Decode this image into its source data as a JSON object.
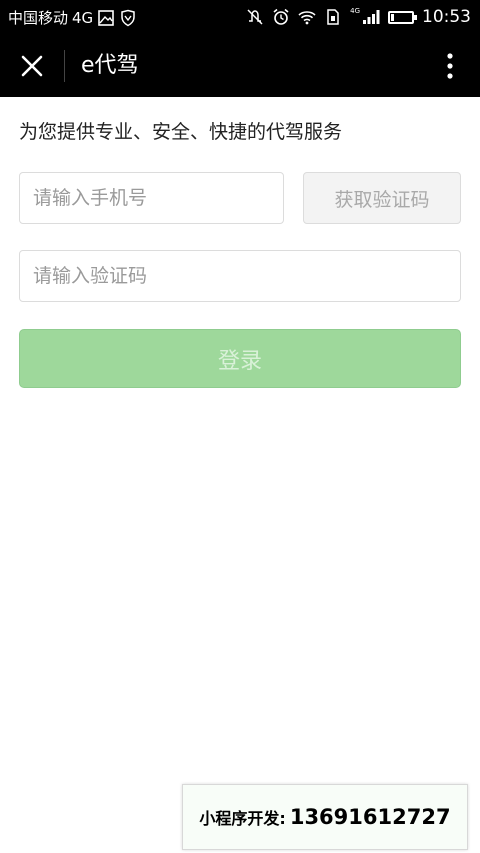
{
  "status_bar": {
    "carrier": "中国移动",
    "network": "4G",
    "network_small": "4G",
    "time": "10:53",
    "icons": [
      "image-icon",
      "shield-icon",
      "mute-icon",
      "alarm-icon",
      "wifi-icon",
      "sim-icon",
      "signal-icon",
      "battery-icon"
    ],
    "battery_level": 0.15
  },
  "title_bar": {
    "title": "e代驾",
    "close_icon": "close-icon",
    "more_icon": "more-vertical-icon"
  },
  "main": {
    "tagline": "为您提供专业、安全、快捷的代驾服务",
    "phone_placeholder": "请输入手机号",
    "get_code_label": "获取验证码",
    "code_placeholder": "请输入验证码",
    "login_label": "登录"
  },
  "banner": {
    "label": "小程序开发:",
    "phone": "13691612727"
  },
  "colors": {
    "header_bg": "#000000",
    "login_bg": "#9ed89b",
    "login_text": "#d9f1d8"
  }
}
